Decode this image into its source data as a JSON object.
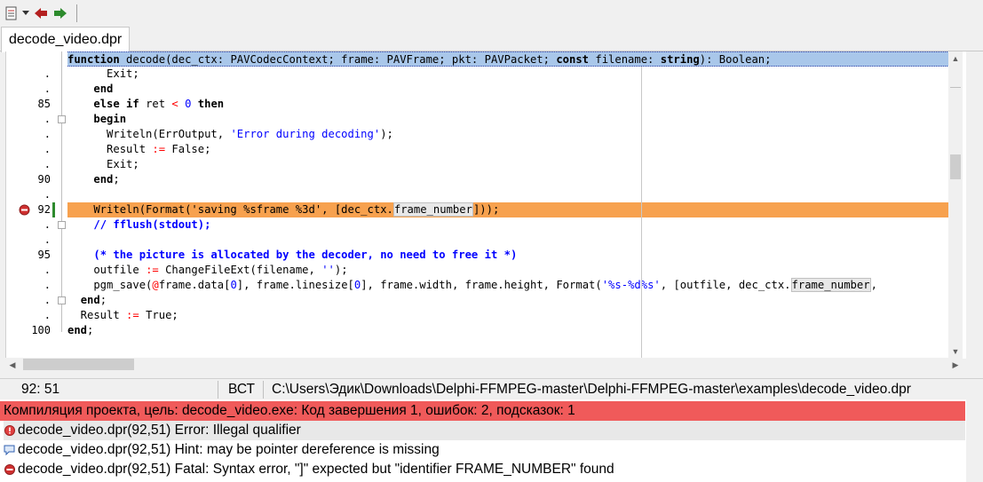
{
  "toolbar": {
    "items": [
      "document-list-icon",
      "dropdown-icon",
      "back-arrow-icon",
      "forward-arrow-icon"
    ]
  },
  "tabs": [
    {
      "label": "decode_video.dpr"
    }
  ],
  "editor": {
    "gutter": [
      {
        "label": ""
      },
      {
        "label": "."
      },
      {
        "label": "."
      },
      {
        "label": "85"
      },
      {
        "label": "."
      },
      {
        "label": "."
      },
      {
        "label": "."
      },
      {
        "label": "."
      },
      {
        "label": "90"
      },
      {
        "label": "."
      },
      {
        "label": "92"
      },
      {
        "label": "."
      },
      {
        "label": "."
      },
      {
        "label": "95"
      },
      {
        "label": "."
      },
      {
        "label": "."
      },
      {
        "label": "."
      },
      {
        "label": "."
      },
      {
        "label": "100"
      }
    ],
    "breakpoint_line": "92"
  },
  "status": {
    "position": "92:  51",
    "mode": "ВСТ",
    "path": "C:\\Users\\Эдик\\Downloads\\Delphi-FFMPEG-master\\Delphi-FFMPEG-master\\examples\\decode_video.dpr"
  },
  "messages": {
    "header": "Компиляция проекта, цель: decode_video.exe: Код завершения 1, ошибок: 2, подсказок: 1",
    "items": [
      {
        "text": "decode_video.dpr(92,51) Error: Illegal qualifier",
        "icon": "error-icon"
      },
      {
        "text": "decode_video.dpr(92,51) Hint: may be pointer dereference is missing",
        "icon": "hint-icon"
      },
      {
        "text": "decode_video.dpr(92,51) Fatal: Syntax error, \"]\" expected but \"identifier FRAME_NUMBER\" found",
        "icon": "fatal-icon"
      }
    ]
  },
  "colors": {
    "header_line": "#a9c7ea",
    "error_line": "#f7a14e",
    "message_header": "#f05a5a",
    "breakpoint": "#d03030"
  }
}
